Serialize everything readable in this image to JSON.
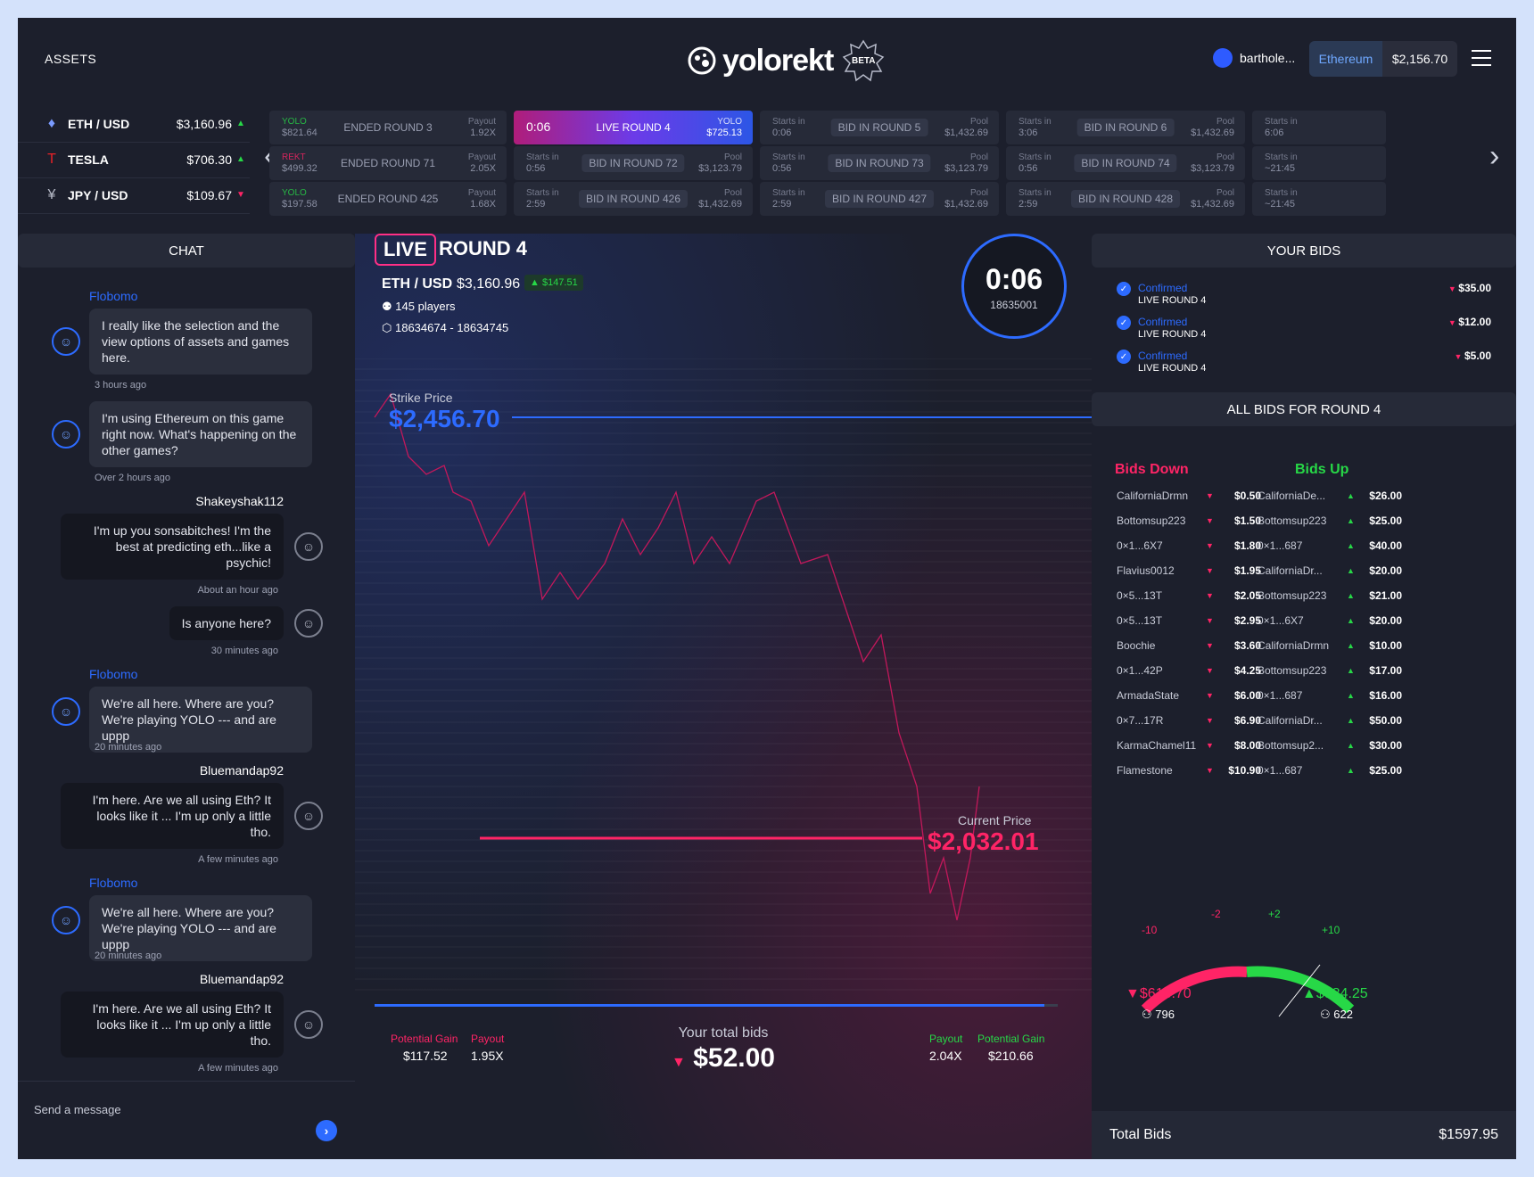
{
  "header": {
    "assets_label": "ASSETS",
    "logo_text": "yolorekt",
    "beta": "BETA",
    "user_name": "barthole...",
    "network": "Ethereum",
    "balance": "$2,156.70"
  },
  "assets": [
    {
      "icon": "eth-icon",
      "name": "ETH / USD",
      "price": "$3,160.96",
      "dir": "up"
    },
    {
      "icon": "tesla-icon",
      "name": "TESLA",
      "price": "$706.30",
      "dir": "up"
    },
    {
      "icon": "yen-icon",
      "name": "JPY / USD",
      "price": "$109.67",
      "dir": "down"
    }
  ],
  "rounds": [
    [
      {
        "a1": "YOLO",
        "a2": "$821.64",
        "mid": "ENDED ROUND 3",
        "b1": "Payout",
        "b2": "1.92X",
        "type": "ended"
      },
      {
        "a1": "0:06",
        "mid": "LIVE ROUND 4",
        "b1": "YOLO",
        "b2": "$725.13",
        "type": "live"
      },
      {
        "a1": "Starts in",
        "a2": "0:06",
        "mid": "BID IN ROUND 5",
        "b1": "Pool",
        "b2": "$1,432.69",
        "type": "bid"
      },
      {
        "a1": "Starts in",
        "a2": "3:06",
        "mid": "BID IN ROUND 6",
        "b1": "Pool",
        "b2": "$1,432.69",
        "type": "bid"
      },
      {
        "a1": "Starts in",
        "a2": "6:06",
        "mid": "",
        "b1": "",
        "b2": "",
        "type": "bid"
      }
    ],
    [
      {
        "a1": "REKT",
        "a2": "$499.32",
        "mid": "ENDED ROUND 71",
        "b1": "Payout",
        "b2": "2.05X",
        "type": "ended"
      },
      {
        "a1": "Starts in",
        "a2": "0:56",
        "mid": "BID IN ROUND 72",
        "b1": "Pool",
        "b2": "$3,123.79",
        "type": "bid"
      },
      {
        "a1": "Starts in",
        "a2": "0:56",
        "mid": "BID IN ROUND 73",
        "b1": "Pool",
        "b2": "$3,123.79",
        "type": "bid"
      },
      {
        "a1": "Starts in",
        "a2": "0:56",
        "mid": "BID IN ROUND 74",
        "b1": "Pool",
        "b2": "$3,123.79",
        "type": "bid"
      },
      {
        "a1": "Starts in",
        "a2": "~21:45",
        "mid": "",
        "b1": "",
        "b2": "",
        "type": "bid"
      }
    ],
    [
      {
        "a1": "YOLO",
        "a2": "$197.58",
        "mid": "ENDED ROUND 425",
        "b1": "Payout",
        "b2": "1.68X",
        "type": "ended"
      },
      {
        "a1": "Starts in",
        "a2": "2:59",
        "mid": "BID IN ROUND 426",
        "b1": "Pool",
        "b2": "$1,432.69",
        "type": "bid"
      },
      {
        "a1": "Starts in",
        "a2": "2:59",
        "mid": "BID IN ROUND 427",
        "b1": "Pool",
        "b2": "$1,432.69",
        "type": "bid"
      },
      {
        "a1": "Starts in",
        "a2": "2:59",
        "mid": "BID IN ROUND 428",
        "b1": "Pool",
        "b2": "$1,432.69",
        "type": "bid"
      },
      {
        "a1": "Starts in",
        "a2": "~21:45",
        "mid": "",
        "b1": "",
        "b2": "",
        "type": "bid"
      }
    ]
  ],
  "chat": {
    "title": "CHAT",
    "placeholder": "Send a message",
    "messages": [
      {
        "user": "Flobomo",
        "text": "I really like the selection and the view options of assets and games here.",
        "time": "3 hours ago",
        "side": "left"
      },
      {
        "user": "",
        "text": "I'm using Ethereum on this game right now. What's happening on the other games?",
        "time": "Over 2 hours ago",
        "side": "left"
      },
      {
        "user": "Shakeyshak112",
        "text": "I'm up you sonsabitches! I'm the best at predicting eth...like a psychic!",
        "time": "About an hour ago",
        "side": "right"
      },
      {
        "user": "",
        "text": "Is anyone here?",
        "time": "30 minutes ago",
        "side": "right"
      },
      {
        "user": "Flobomo",
        "text": "We're all here. Where are you? We're playing YOLO --- and are uppp",
        "time": "20 minutes ago",
        "side": "left"
      },
      {
        "user": "Bluemandap92",
        "text": "I'm here. Are we all using Eth? It looks like it ... I'm up only a little tho.",
        "time": "A few minutes ago",
        "side": "right"
      },
      {
        "user": "Flobomo",
        "text": "We're all here. Where are you? We're playing YOLO --- and are uppp",
        "time": "20 minutes ago",
        "side": "left"
      },
      {
        "user": "Bluemandap92",
        "text": "I'm here. Are we all using Eth? It looks like it ... I'm up only a little tho.",
        "time": "A few minutes ago",
        "side": "right"
      }
    ]
  },
  "round": {
    "live": "LIVE",
    "title": "ROUND 4",
    "pair": "ETH / USD",
    "price": "$3,160.96",
    "change": "$147.51",
    "players": "145 players",
    "blocks": "18634674 - 18634745",
    "timer": "0:06",
    "timer_sub": "18635001",
    "strike_label": "Strike Price",
    "strike": "$2,456.70",
    "current_label": "Current Price",
    "current": "$2,032.01",
    "progress": 0.98
  },
  "bottom": {
    "pg_label": "Potential Gain",
    "pg_left": "$117.52",
    "payout_label": "Payout",
    "payout_left": "1.95X",
    "total_label": "Your total bids",
    "total": "$52.00",
    "payout_right": "2.04X",
    "pg_right": "$210.66"
  },
  "your_bids": {
    "title": "YOUR BIDS",
    "items": [
      {
        "status": "Confirmed",
        "round": "LIVE ROUND 4",
        "amount": "$35.00"
      },
      {
        "status": "Confirmed",
        "round": "LIVE ROUND 4",
        "amount": "$12.00"
      },
      {
        "status": "Confirmed",
        "round": "LIVE ROUND 4",
        "amount": "$5.00"
      }
    ]
  },
  "all_bids": {
    "title": "ALL BIDS FOR ROUND 4",
    "down_label": "Bids Down",
    "up_label": "Bids Up",
    "down": [
      [
        "CaliforniaDrmn",
        "$0.50"
      ],
      [
        "Bottomsup223",
        "$1.50"
      ],
      [
        "0×1...6X7",
        "$1.80"
      ],
      [
        "Flavius0012",
        "$1.95"
      ],
      [
        "0×5...13T",
        "$2.05"
      ],
      [
        "0×5...13T",
        "$2.95"
      ],
      [
        "Boochie",
        "$3.60"
      ],
      [
        "0×1...42P",
        "$4.25"
      ],
      [
        "ArmadaState",
        "$6.00"
      ],
      [
        "0×7...17R",
        "$6.90"
      ],
      [
        "KarmaChamel11",
        "$8.00"
      ],
      [
        "Flamestone",
        "$10.90"
      ]
    ],
    "up": [
      [
        "CaliforniaDe...",
        "$26.00"
      ],
      [
        "Bottomsup223",
        "$25.00"
      ],
      [
        "0×1...687",
        "$40.00"
      ],
      [
        "CaliforniaDr...",
        "$20.00"
      ],
      [
        "Bottomsup223",
        "$21.00"
      ],
      [
        "0×1...6X7",
        "$20.00"
      ],
      [
        "CaliforniaDrmn",
        "$10.00"
      ],
      [
        "Bottomsup223",
        "$17.00"
      ],
      [
        "0×1...687",
        "$16.00"
      ],
      [
        "CaliforniaDr...",
        "$50.00"
      ],
      [
        "Bottomsup2...",
        "$30.00"
      ],
      [
        "0×1...687",
        "$25.00"
      ]
    ]
  },
  "gauge": {
    "l1": "-10",
    "l2": "-2",
    "l3": "+2",
    "l4": "+10",
    "down_total": "$613.70",
    "up_total": "$984.25",
    "down_count": "796",
    "up_count": "622",
    "total_label": "Total Bids",
    "total": "$1597.95"
  },
  "colors": {
    "accent": "#2d6bff",
    "down": "#ff2466",
    "up": "#27d847"
  }
}
